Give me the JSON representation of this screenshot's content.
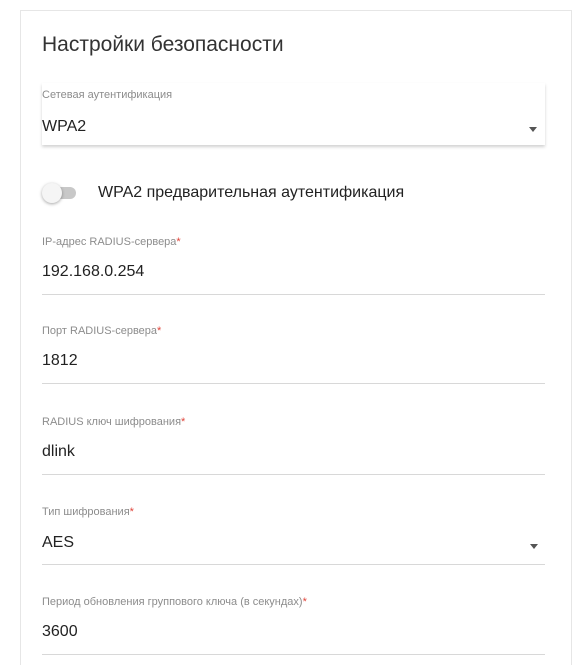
{
  "section_title": "Настройки безопасности",
  "network_auth": {
    "label": "Сетевая аутентификация",
    "value": "WPA2"
  },
  "preauth_toggle": {
    "label": "WPA2 предварительная аутентификация",
    "enabled": false
  },
  "radius_ip": {
    "label": "IP-адрес RADIUS-сервера",
    "required_mark": "*",
    "value": "192.168.0.254"
  },
  "radius_port": {
    "label": "Порт RADIUS-сервера",
    "required_mark": "*",
    "value": "1812"
  },
  "radius_key": {
    "label": "RADIUS ключ шифрования",
    "required_mark": "*",
    "value": "dlink"
  },
  "encryption_type": {
    "label": "Тип шифрования",
    "required_mark": "*",
    "value": "AES"
  },
  "group_key_period": {
    "label": "Период обновления группового ключа (в секундах)",
    "required_mark": "*",
    "value": "3600"
  }
}
